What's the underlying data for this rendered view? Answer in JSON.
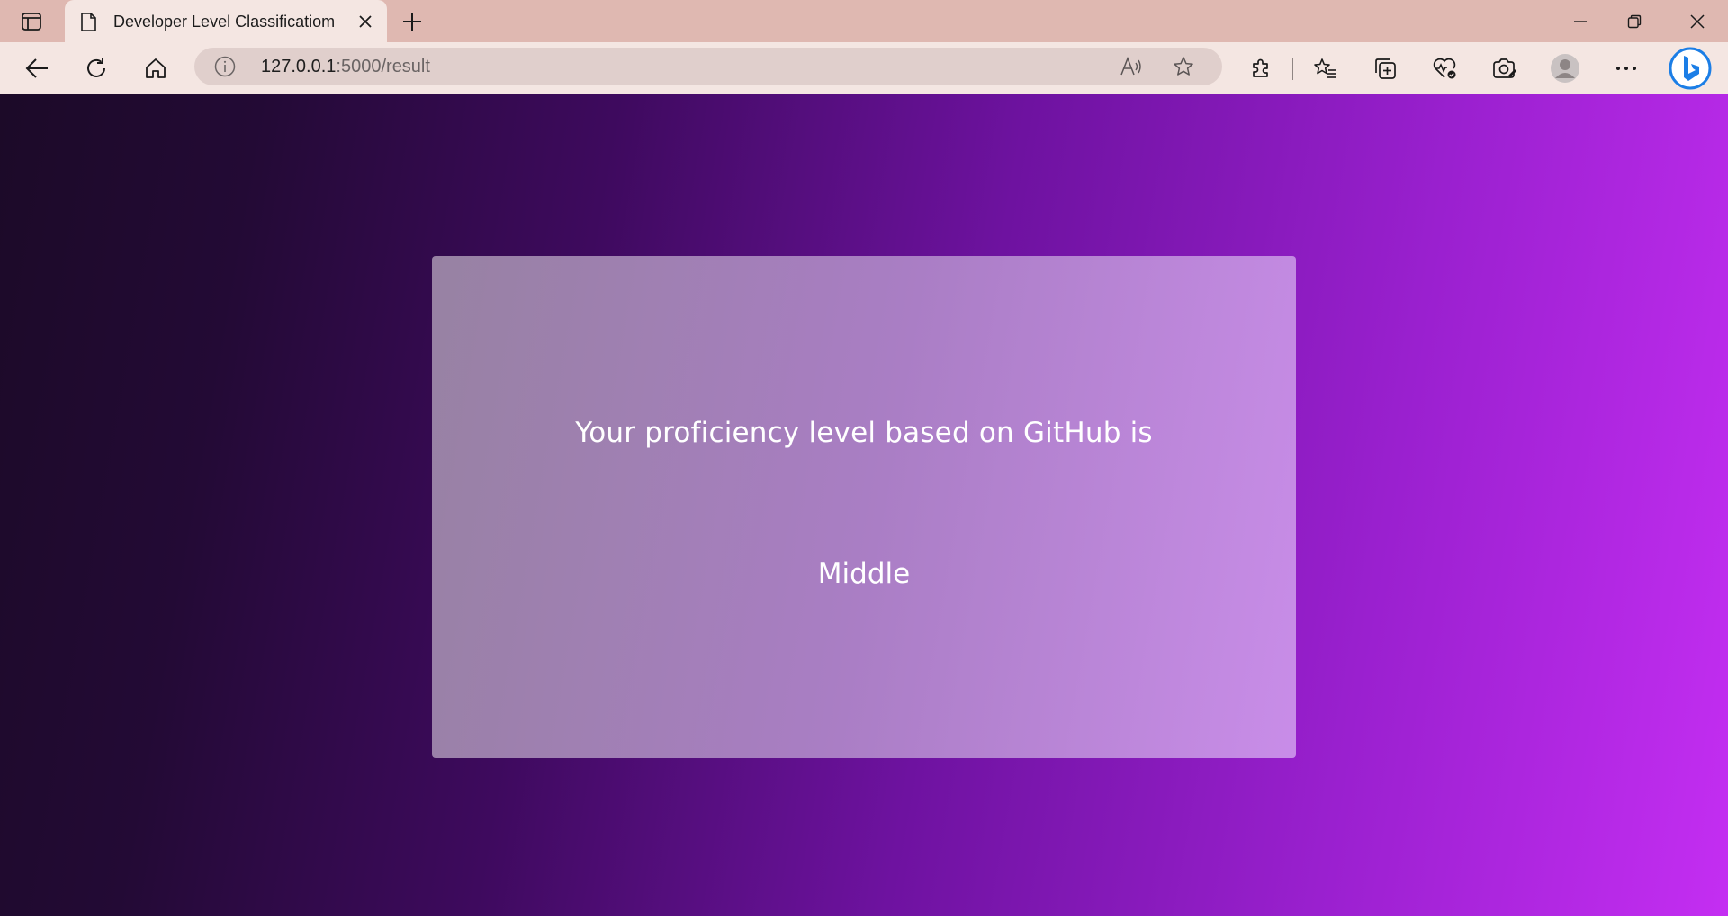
{
  "browser": {
    "tab": {
      "title": "Developer Level Classificatiom"
    },
    "address_bar": {
      "url_host": "127.0.0.1",
      "url_rest": ":5000/result"
    },
    "icons": {
      "tab_actions": "tab-actions-icon",
      "page": "page-icon",
      "close_tab": "close-icon",
      "new_tab": "plus-icon",
      "minimize": "minimize-icon",
      "restore": "restore-icon",
      "close_window": "close-icon",
      "back": "back-arrow-icon",
      "refresh": "refresh-icon",
      "home": "home-icon",
      "site_info": "info-icon",
      "read_aloud": "read-aloud-icon",
      "favorite": "star-icon",
      "extensions": "puzzle-icon",
      "favorites": "favorites-icon",
      "collections": "collections-icon",
      "browser_essentials": "heart-pulse-icon",
      "screenshot": "screenshot-icon",
      "profile": "avatar-icon",
      "more": "ellipsis-icon",
      "copilot": "bing-icon"
    }
  },
  "page": {
    "heading": "Your proficiency level based on GitHub is",
    "result": "Middle"
  },
  "colors": {
    "tabstrip_bg": "#dfb8b1",
    "toolbar_bg": "#f4e6e2",
    "gradient_start": "#1c0a28",
    "gradient_end": "#c42ef2",
    "bing_blue": "#1b7ee6"
  }
}
